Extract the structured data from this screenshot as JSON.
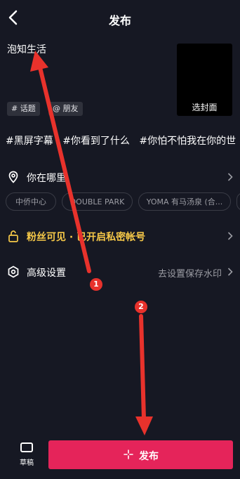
{
  "header": {
    "title": "发布"
  },
  "post": {
    "caption": "泡知生活"
  },
  "cover": {
    "label": "选封面"
  },
  "chips": {
    "topic": "# 话题",
    "friends": "@ 朋友"
  },
  "hashtags": [
    "#黑屏字幕",
    "#你看到了什么",
    "#你怕不怕我在你的世"
  ],
  "location": {
    "label": "你在哪里",
    "suggestions": [
      "中侨中心",
      "DOUBLE PARK",
      "YOMA 有马汤泉 (合...",
      ""
    ]
  },
  "privacy": {
    "label": "粉丝可见 · 已开启私密帐号",
    "color": "#f7c948"
  },
  "advanced": {
    "label": "高级设置",
    "hint": "去设置保存水印"
  },
  "bottom": {
    "draft_label": "草稿",
    "publish_label": "发布",
    "publish_color": "#e5245a"
  },
  "annotations": {
    "step1": "1",
    "step2": "2",
    "arrow_color": "#e8322c"
  },
  "colors": {
    "background": "#161823"
  }
}
